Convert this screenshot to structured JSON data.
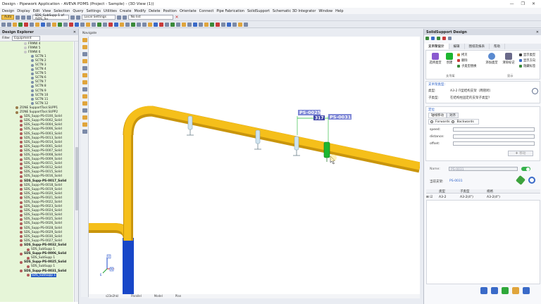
{
  "window": {
    "title": "Design - Pipework Application - AVEVA PDMS (Project - Sample) - (3D View (1))",
    "controls": [
      "—",
      "❐",
      "✕"
    ]
  },
  "menu": [
    "Design",
    "Display",
    "Edit",
    "View",
    "Selection",
    "Query",
    "Settings",
    "Utilities",
    "Create",
    "Modify",
    "Delete",
    "Position",
    "Orientate",
    "Connect",
    "Pipe Fabrication",
    "SolidSupport",
    "Schematic 3D Integrator",
    "Window",
    "Help"
  ],
  "toolbar": {
    "auto_label": "Auto",
    "element_combo": "SDS_SubSupp 1 of /SDS_Su",
    "settings_combo": "Local Settings",
    "list_combo": "No list"
  },
  "left_panel": {
    "title": "Design Explorer",
    "filter_label": "Filter",
    "filter_value": "Equipment",
    "tree": [
      {
        "label": "FRMW 4",
        "indent": 34,
        "color": "#c7c7c7"
      },
      {
        "label": "FRMW 5",
        "indent": 34,
        "color": "#c7c7c7"
      },
      {
        "label": "FRMW 6",
        "indent": 34,
        "color": "#c7c7c7"
      },
      {
        "label": "SCTN 1",
        "indent": 44,
        "color": "#7d8fa8"
      },
      {
        "label": "SCTN 2",
        "indent": 44,
        "color": "#7d8fa8"
      },
      {
        "label": "SCTN 3",
        "indent": 44,
        "color": "#7d8fa8"
      },
      {
        "label": "SCTN 4",
        "indent": 44,
        "color": "#7d8fa8"
      },
      {
        "label": "SCTN 5",
        "indent": 44,
        "color": "#7d8fa8"
      },
      {
        "label": "SCTN 6",
        "indent": 44,
        "color": "#7d8fa8"
      },
      {
        "label": "SCTN 7",
        "indent": 44,
        "color": "#7d8fa8"
      },
      {
        "label": "SCTN 8",
        "indent": 44,
        "color": "#7d8fa8"
      },
      {
        "label": "SCTN 9",
        "indent": 44,
        "color": "#7d8fa8"
      },
      {
        "label": "SCTN 10",
        "indent": 44,
        "color": "#7d8fa8"
      },
      {
        "label": "SCTN 11",
        "indent": 44,
        "color": "#7d8fa8"
      },
      {
        "label": "SCTN 12",
        "indent": 44,
        "color": "#7d8fa8"
      },
      {
        "label": "ZONE SupportTool.SUPP1",
        "indent": 22,
        "color": "#9a7a4a"
      },
      {
        "label": "ZONE SupportTool.SUPP2",
        "indent": 22,
        "color": "#9a7a4a"
      },
      {
        "label": "SDS_Supp-PS-0100_Solid",
        "indent": 28,
        "color": "#b05a5a"
      },
      {
        "label": "SDS_Supp-PS-0002_Solid",
        "indent": 28,
        "color": "#b05a5a"
      },
      {
        "label": "SDS_Supp-PS-0004_Solid",
        "indent": 28,
        "color": "#b05a5a"
      },
      {
        "label": "SDS_Supp-PS-0006_Solid",
        "indent": 28,
        "color": "#b05a5a"
      },
      {
        "label": "SDS_Supp-PS-0003_Solid",
        "indent": 28,
        "color": "#b05a5a"
      },
      {
        "label": "SDS_Supp-PS-0013_Solid",
        "indent": 28,
        "color": "#b05a5a"
      },
      {
        "label": "SDS_Supp-PS-0014_Solid",
        "indent": 28,
        "color": "#b05a5a"
      },
      {
        "label": "SDS_Supp-PS-0001_Solid",
        "indent": 28,
        "color": "#b05a5a"
      },
      {
        "label": "SDS_Supp-PS-0007_Solid",
        "indent": 28,
        "color": "#b05a5a"
      },
      {
        "label": "SDS_Supp-PS-0008_Solid",
        "indent": 28,
        "color": "#b05a5a"
      },
      {
        "label": "SDS_Supp-PS-0009_Solid",
        "indent": 28,
        "color": "#b05a5a"
      },
      {
        "label": "SDS_Supp-PS-0011_Solid",
        "indent": 28,
        "color": "#b05a5a"
      },
      {
        "label": "SDS_Supp-PS-0012_Solid",
        "indent": 28,
        "color": "#b05a5a"
      },
      {
        "label": "SDS_Supp-PS-0015_Solid",
        "indent": 28,
        "color": "#b05a5a"
      },
      {
        "label": "SDS_Supp-PS-0016_Solid",
        "indent": 28,
        "color": "#b05a5a"
      },
      {
        "label": "SDS_Supp-PS-0017_Solid",
        "indent": 28,
        "color": "#b05a5a",
        "bold": true
      },
      {
        "label": "SDS_Supp-PS-0018_Solid",
        "indent": 28,
        "color": "#b05a5a"
      },
      {
        "label": "SDS_Supp-PS-0019_Solid",
        "indent": 28,
        "color": "#b05a5a"
      },
      {
        "label": "SDS_Supp-PS-0020_Solid",
        "indent": 28,
        "color": "#b05a5a"
      },
      {
        "label": "SDS_Supp-PS-0021_Solid",
        "indent": 28,
        "color": "#b05a5a"
      },
      {
        "label": "SDS_Supp-PS-0022_Solid",
        "indent": 28,
        "color": "#b05a5a"
      },
      {
        "label": "SDS_Supp-PS-0023_Solid",
        "indent": 28,
        "color": "#b05a5a"
      },
      {
        "label": "SDS_Supp-PS-0024_Solid",
        "indent": 28,
        "color": "#b05a5a"
      },
      {
        "label": "SDS_Supp-PS-0010_Solid",
        "indent": 28,
        "color": "#b05a5a"
      },
      {
        "label": "SDS_Supp-PS-0025_Solid",
        "indent": 28,
        "color": "#b05a5a"
      },
      {
        "label": "SDS_Supp-PS-0026_Solid",
        "indent": 28,
        "color": "#b05a5a"
      },
      {
        "label": "SDS_Supp-PS-0028_Solid",
        "indent": 28,
        "color": "#b05a5a"
      },
      {
        "label": "SDS_Supp-PS-0029_Solid",
        "indent": 28,
        "color": "#b05a5a"
      },
      {
        "label": "SDS_Supp-PS-0030_Solid",
        "indent": 28,
        "color": "#b05a5a"
      },
      {
        "label": "SDS_Supp-PS-0027_Solid",
        "indent": 28,
        "color": "#b05a5a"
      },
      {
        "label": "SDS_Supp-PS-0032_Solid",
        "indent": 28,
        "color": "#b05a5a",
        "bold": true
      },
      {
        "label": "SDS_SubSupp 1",
        "indent": 38,
        "color": "#b05a5a"
      },
      {
        "label": "SDS_Supp-PS-0006_Solid",
        "indent": 28,
        "color": "#b05a5a",
        "bold": true
      },
      {
        "label": "SDS_SubSupp 1",
        "indent": 38,
        "color": "#b05a5a"
      },
      {
        "label": "SDS_Supp-PS-0025_Solid",
        "indent": 28,
        "color": "#b05a5a",
        "bold": true
      },
      {
        "label": "SDS_SubSupp 1",
        "indent": 38,
        "color": "#b05a5a"
      },
      {
        "label": "SDS_Supp-PS-0031_Solid",
        "indent": 28,
        "color": "#b05a5a",
        "bold": true
      },
      {
        "label": "SDS_SubSupp 1",
        "indent": 38,
        "color": "#b05a5a",
        "selected": true
      }
    ]
  },
  "navigator": {
    "label": "Navigate"
  },
  "viewport": {
    "tag_left": "PS-0025",
    "tag_right": "PS-0031",
    "dimension": "317",
    "axis_labels": [
      "U",
      "N",
      "E"
    ]
  },
  "statusbar": [
    "s23e2hkl",
    "Parallel",
    "Model",
    "Plan"
  ],
  "right_panel": {
    "title": "SolidSupport Design",
    "tabs": [
      "支吊架设计",
      "编辑",
      "图纸及报表",
      "帮助"
    ],
    "ribbon_buttons": {
      "select_type": "选择类型",
      "create": "创建",
      "copy": "拷贝",
      "delete": "删除",
      "subtype_replace": "子类型替换",
      "add_type": "添加类型",
      "clear_mark": "清除标记",
      "show_type": "显示类型",
      "show_direction": "显示方向",
      "hide_label": "隐藏标签"
    },
    "ribbon_groups": [
      "支吊架",
      "显示"
    ],
    "type_section": {
      "head": "支吊架类型:",
      "type_label": "类型:",
      "type_value": "A3-2  Π型结构支架（两管跨）",
      "subtype_label": "子类型:",
      "subtype_value": "在结构柱固定的支架子类型?"
    },
    "position_section": {
      "head": "定位",
      "tabs": [
        "轴线移动",
        "对齐"
      ],
      "radio_forward": "Forwards",
      "radio_backward": "Backwards",
      "speed_label": "speed:",
      "distance_label": "distance:",
      "offset_label": "offset:",
      "apply_button": "移动"
    },
    "name_label": "Name:",
    "name_value": "PS-0031",
    "current_support_label": "当前支架:",
    "current_support_value": "PS-0031",
    "grid": {
      "headers": [
        "类型",
        "子类型",
        "规格"
      ],
      "rows": [
        [
          "A3-2",
          "A3-2(4\")",
          "A3-2(4\")"
        ]
      ]
    }
  },
  "colors": {
    "pipe": "#f5bf1a",
    "pipe_shade": "#c9950c",
    "column": "#1746c8",
    "clamp_selected": "#1cb630",
    "clamp": "#cfe4f0",
    "tag_bg": "#7f88d6"
  }
}
